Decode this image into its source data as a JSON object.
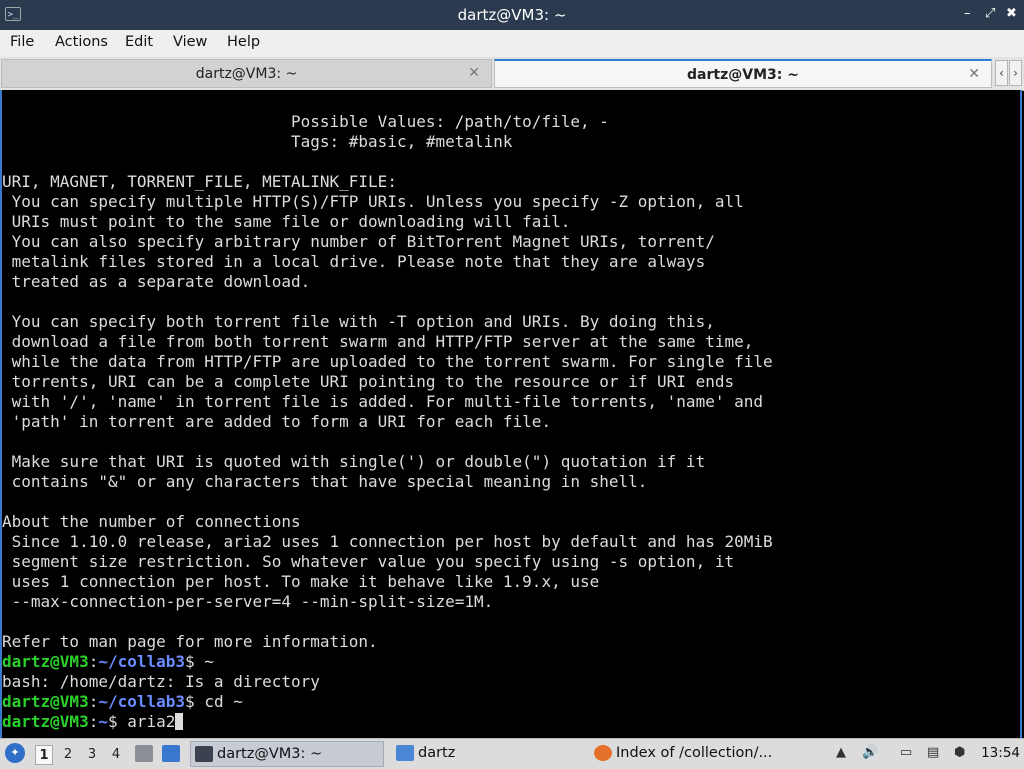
{
  "window": {
    "title": "dartz@VM3: ~",
    "app_icon_glyph": ">_"
  },
  "window_controls": {
    "minimize": "–",
    "maximize": "⤢",
    "close": "✖"
  },
  "menubar": {
    "items": [
      "File",
      "Actions",
      "Edit",
      "View",
      "Help"
    ]
  },
  "tabs": [
    {
      "label": "dartz@VM3: ~",
      "active": false,
      "close": "✕"
    },
    {
      "label": "dartz@VM3: ~",
      "active": true,
      "close": "✕"
    }
  ],
  "tab_scroll": {
    "left": "‹",
    "right": "›"
  },
  "terminal": {
    "output_lines": [
      "                              Possible Values: /path/to/file, -",
      "                              Tags: #basic, #metalink",
      "",
      "URI, MAGNET, TORRENT_FILE, METALINK_FILE:",
      " You can specify multiple HTTP(S)/FTP URIs. Unless you specify -Z option, all",
      " URIs must point to the same file or downloading will fail.",
      " You can also specify arbitrary number of BitTorrent Magnet URIs, torrent/",
      " metalink files stored in a local drive. Please note that they are always",
      " treated as a separate download.",
      "",
      " You can specify both torrent file with -T option and URIs. By doing this,",
      " download a file from both torrent swarm and HTTP/FTP server at the same time,",
      " while the data from HTTP/FTP are uploaded to the torrent swarm. For single file",
      " torrents, URI can be a complete URI pointing to the resource or if URI ends",
      " with '/', 'name' in torrent file is added. For multi-file torrents, 'name' and",
      " 'path' in torrent are added to form a URI for each file.",
      "",
      " Make sure that URI is quoted with single(') or double(\") quotation if it",
      " contains \"&\" or any characters that have special meaning in shell.",
      "",
      "About the number of connections",
      " Since 1.10.0 release, aria2 uses 1 connection per host by default and has 20MiB",
      " segment size restriction. So whatever value you specify using -s option, it",
      " uses 1 connection per host. To make it behave like 1.9.x, use",
      " --max-connection-per-server=4 --min-split-size=1M.",
      "",
      "Refer to man page for more information."
    ],
    "session": [
      {
        "user": "dartz@VM3",
        "path": "~/collab3",
        "command": "~"
      },
      {
        "output": "bash: /home/dartz: Is a directory"
      },
      {
        "user": "dartz@VM3",
        "path": "~/collab3",
        "command": "cd ~"
      },
      {
        "user": "dartz@VM3",
        "path": "~",
        "command": "aria2"
      }
    ],
    "prompt_suffix": "$ ",
    "colors": {
      "prompt_user": "#2bd02b",
      "prompt_path": "#6a8cff",
      "text": "#dcdcdc",
      "background": "#000000"
    }
  },
  "taskbar": {
    "workspaces": [
      "1",
      "2",
      "3",
      "4"
    ],
    "active_workspace": "1",
    "tasks": [
      {
        "label": "dartz@VM3: ~",
        "icon": "terminal-icon"
      },
      {
        "label": "dartz",
        "icon": "folder-icon"
      },
      {
        "label": "Index of /collection/...",
        "icon": "firefox-icon"
      }
    ],
    "clock": "13:54"
  }
}
